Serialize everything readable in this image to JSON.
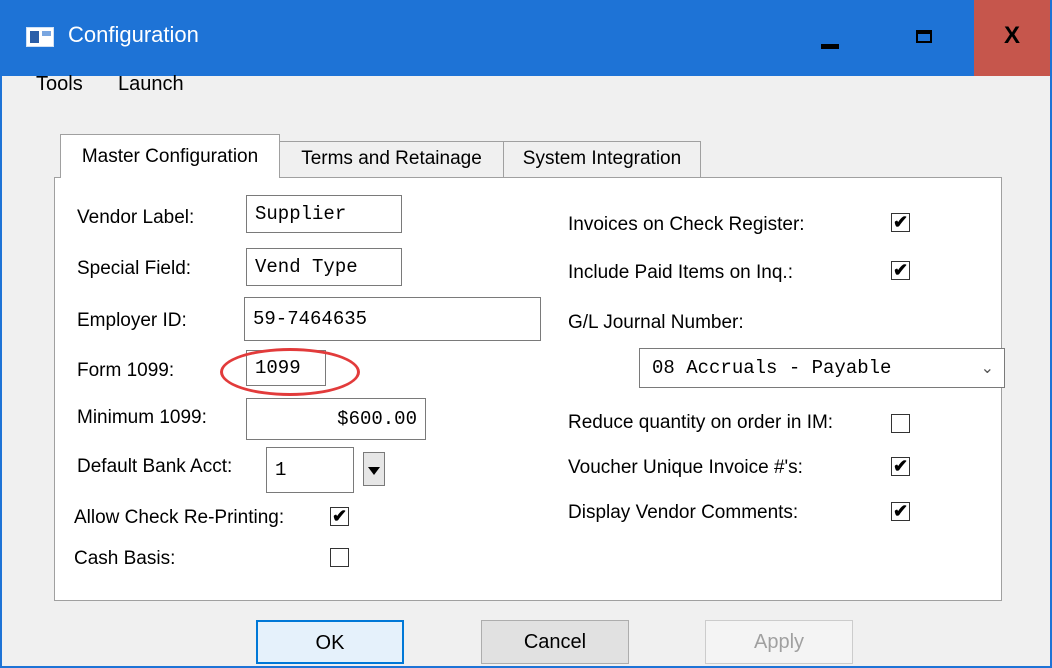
{
  "window": {
    "title": "Configuration",
    "close_glyph": "X"
  },
  "menu": {
    "tools": "Tools",
    "launch": "Launch"
  },
  "tabs": [
    {
      "label": "Master Configuration",
      "active": true
    },
    {
      "label": "Terms and Retainage",
      "active": false
    },
    {
      "label": "System Integration",
      "active": false
    }
  ],
  "left": {
    "vendor_label": {
      "label": "Vendor Label:",
      "value": "Supplier"
    },
    "special_field": {
      "label": "Special Field:",
      "value": "Vend Type"
    },
    "employer_id": {
      "label": "Employer ID:",
      "value": "59-7464635"
    },
    "form_1099": {
      "label": "Form 1099:",
      "value": "1099"
    },
    "minimum_1099": {
      "label": "Minimum 1099:",
      "value": "$600.00"
    },
    "default_bank_acct": {
      "label": "Default Bank Acct:",
      "value": "1"
    },
    "allow_check_reprinting": {
      "label": "Allow Check Re-Printing:",
      "checked": true
    },
    "cash_basis": {
      "label": "Cash Basis:",
      "checked": false
    }
  },
  "right": {
    "invoices_on_check_register": {
      "label": "Invoices on Check Register:",
      "checked": true
    },
    "include_paid_items": {
      "label": "Include Paid Items on Inq.:",
      "checked": true
    },
    "gl_journal_number": {
      "label": "G/L Journal Number:",
      "value": "08 Accruals - Payable"
    },
    "reduce_quantity": {
      "label": "Reduce quantity on order in IM:",
      "checked": false
    },
    "voucher_unique_invoice": {
      "label": "Voucher Unique Invoice #'s:",
      "checked": true
    },
    "display_vendor_comments": {
      "label": "Display Vendor Comments:",
      "checked": true
    }
  },
  "buttons": {
    "ok": "OK",
    "cancel": "Cancel",
    "apply": "Apply"
  },
  "colors": {
    "titlebar": "#1e73d6",
    "close_button": "#c6564c",
    "annotation": "#e23b3b"
  },
  "check_mark": "✔"
}
